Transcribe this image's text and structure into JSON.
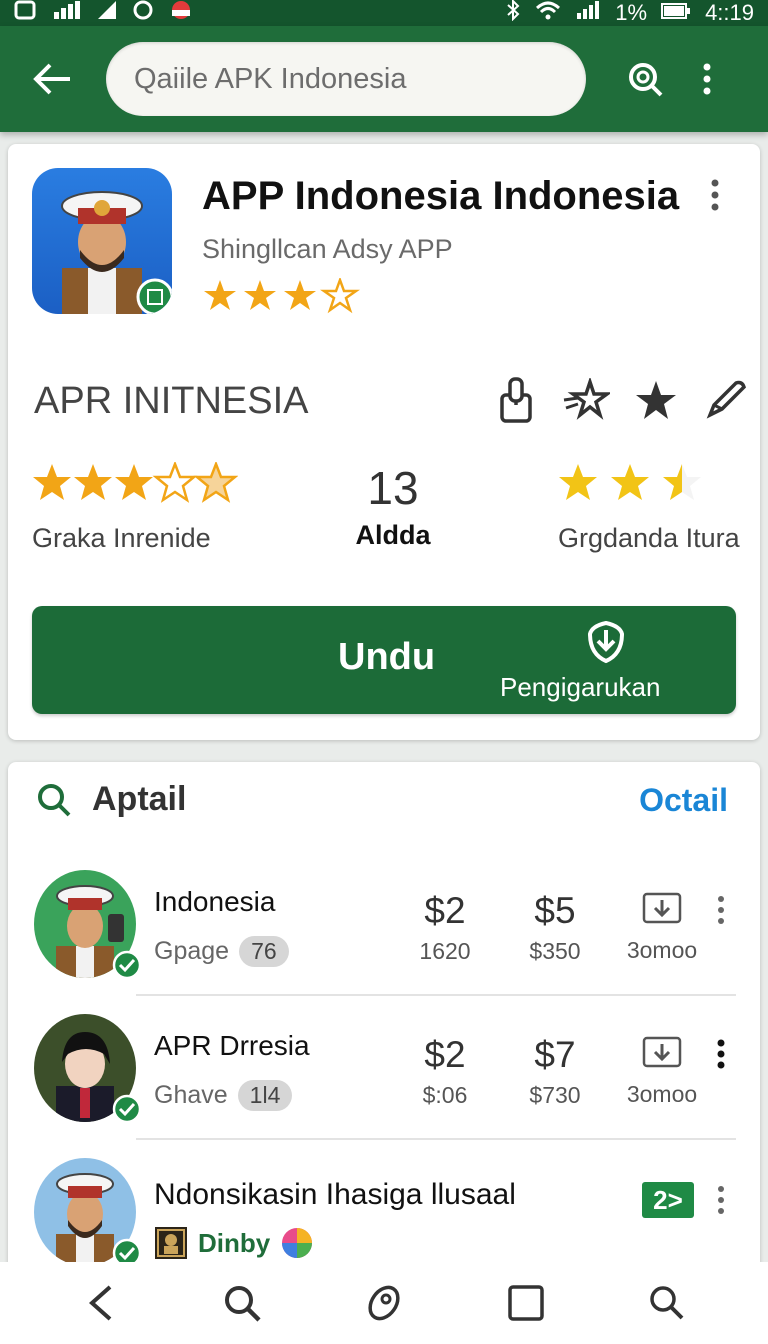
{
  "status_bar": {
    "battery": "1%",
    "time": "4::19"
  },
  "app_bar": {
    "search_placeholder": "Qaiile APK Indonesia"
  },
  "app": {
    "title": "APP Indonesia Indonesia",
    "subtitle": "Shingllcan Adsy APP",
    "rating_stars": 3.5,
    "section_name": "APR INITNESIA",
    "stats": [
      {
        "stars": 3.5,
        "label": "Graka Inrenide"
      },
      {
        "value": "13",
        "label": "Aldda"
      },
      {
        "stars": 2.5,
        "label": "Grgdanda Itura"
      }
    ],
    "install": {
      "label": "Undu",
      "sub_label": "Pengigarukan"
    }
  },
  "list": {
    "title": "Aptail",
    "link": "Octail",
    "items": [
      {
        "name": "Indonesia",
        "meta": "Gpage",
        "badge": "76",
        "price1": "$2",
        "sub1": "1620",
        "price2": "$5",
        "sub2": "$350",
        "downloads": "3omoo"
      },
      {
        "name": "APR Drresia",
        "meta": "Ghave",
        "badge": "1l4",
        "price1": "$2",
        "sub1": "$:06",
        "price2": "$7",
        "sub2": "$730",
        "downloads": "3omoo"
      },
      {
        "name": "Ndonsikasin Ihasiga llusaal",
        "meta": "Dinby",
        "tag": "2>"
      }
    ]
  },
  "colors": {
    "primary": "#1f6d3a",
    "star": "#f2a516",
    "link": "#1a86d6"
  }
}
